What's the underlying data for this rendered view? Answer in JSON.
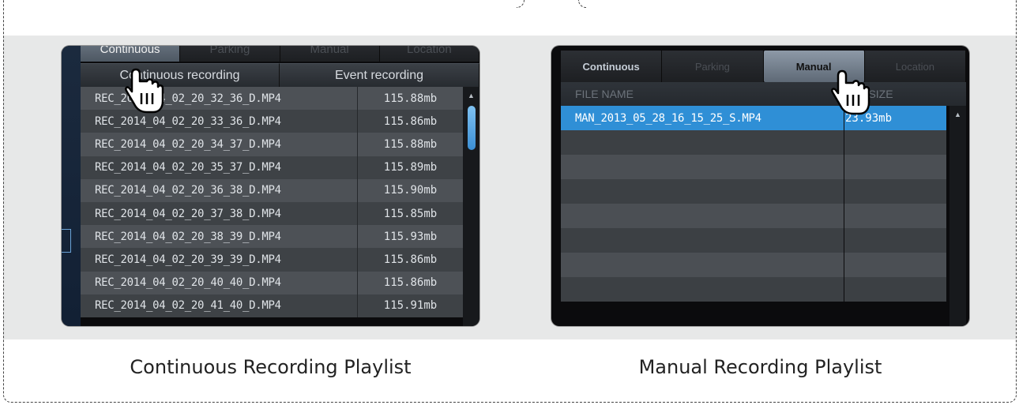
{
  "captions": {
    "left": "Continuous Recording Playlist",
    "right": "Manual Recording Playlist"
  },
  "left_panel": {
    "tabs": [
      "Continuous",
      "Parking",
      "Manual",
      "Location"
    ],
    "active_tab": "Continuous",
    "sub_tabs": [
      "Continuous recording",
      "Event recording"
    ],
    "active_sub_tab": "Continuous recording",
    "files": [
      {
        "name": "REC_2014_04_02_20_32_36_D.MP4",
        "size": "115.88mb"
      },
      {
        "name": "REC_2014_04_02_20_33_36_D.MP4",
        "size": "115.86mb"
      },
      {
        "name": "REC_2014_04_02_20_34_37_D.MP4",
        "size": "115.88mb"
      },
      {
        "name": "REC_2014_04_02_20_35_37_D.MP4",
        "size": "115.89mb"
      },
      {
        "name": "REC_2014_04_02_20_36_38_D.MP4",
        "size": "115.90mb"
      },
      {
        "name": "REC_2014_04_02_20_37_38_D.MP4",
        "size": "115.85mb"
      },
      {
        "name": "REC_2014_04_02_20_38_39_D.MP4",
        "size": "115.93mb"
      },
      {
        "name": "REC_2014_04_02_20_39_39_D.MP4",
        "size": "115.86mb"
      },
      {
        "name": "REC_2014_04_02_20_40_40_D.MP4",
        "size": "115.86mb"
      },
      {
        "name": "REC_2014_04_02_20_41_40_D.MP4",
        "size": "115.91mb"
      }
    ]
  },
  "right_panel": {
    "tabs": [
      "Continuous",
      "Parking",
      "Manual",
      "Location"
    ],
    "active_tab": "Manual",
    "headers": {
      "name": "FILE NAME",
      "size": "FILE SIZE"
    },
    "files": [
      {
        "name": "MAN_2013_05_28_16_15_25_S.MP4",
        "size": "23.93mb",
        "selected": true
      }
    ],
    "empty_rows": 7
  },
  "colors": {
    "selection": "#2f8fd6",
    "scroll_thumb": "#5aa9e6",
    "band": "#e7e8e8"
  },
  "icons": {
    "cursor": "hand-pointer-icon",
    "scroll_up": "triangle-up-icon"
  }
}
